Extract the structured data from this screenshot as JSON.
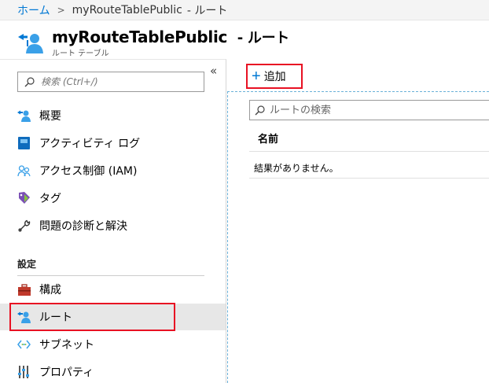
{
  "breadcrumb": {
    "home": "ホーム",
    "separator": ">",
    "resource": "myRouteTablePublic",
    "current": "- ルート"
  },
  "header": {
    "title_main": "myRouteTablePublic",
    "title_suffix": "- ルート",
    "subtitle": "ルート テーブル",
    "icon": "route-table-icon"
  },
  "sidebar": {
    "collapse_label": "«",
    "search_placeholder": "検索 (Ctrl+/)",
    "items": [
      {
        "label": "概要",
        "icon": "overview-icon"
      },
      {
        "label": "アクティビティ ログ",
        "icon": "activity-log-icon"
      },
      {
        "label": "アクセス制御 (IAM)",
        "icon": "access-control-icon"
      },
      {
        "label": "タグ",
        "icon": "tag-icon"
      },
      {
        "label": "問題の診断と解決",
        "icon": "wrench-icon"
      }
    ],
    "section_title": "設定",
    "settings_items": [
      {
        "label": "構成",
        "icon": "toolbox-icon"
      },
      {
        "label": "ルート",
        "icon": "route-icon",
        "active": true
      },
      {
        "label": "サブネット",
        "icon": "subnet-icon"
      },
      {
        "label": "プロパティ",
        "icon": "properties-icon"
      }
    ]
  },
  "toolbar": {
    "add_label": "追加",
    "add_icon": "+"
  },
  "main": {
    "search_placeholder": "ルートの検索",
    "column_name": "名前",
    "empty_message": "結果がありません。"
  },
  "colors": {
    "accent": "#0078d4",
    "highlight": "#e81123",
    "active_bg": "#e7e7e7"
  }
}
